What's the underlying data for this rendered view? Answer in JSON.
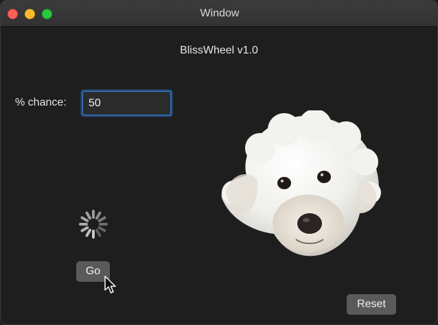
{
  "window": {
    "title": "Window"
  },
  "app": {
    "title": "BlissWheel v1.0"
  },
  "form": {
    "chance_label": "% chance:",
    "chance_value": "50"
  },
  "buttons": {
    "go_label": "Go",
    "reset_label": "Reset"
  },
  "image": {
    "subject": "white fluffy dog face"
  },
  "colors": {
    "background": "#1e1e1e",
    "accent_focus": "#2f6db5",
    "button": "#5a5a5a",
    "close": "#fe5f57",
    "minimize": "#febc2e",
    "maximize": "#28c840"
  },
  "icons": [
    "close-icon",
    "minimize-icon",
    "maximize-icon",
    "loading-spinner-icon",
    "mouse-cursor-icon"
  ]
}
